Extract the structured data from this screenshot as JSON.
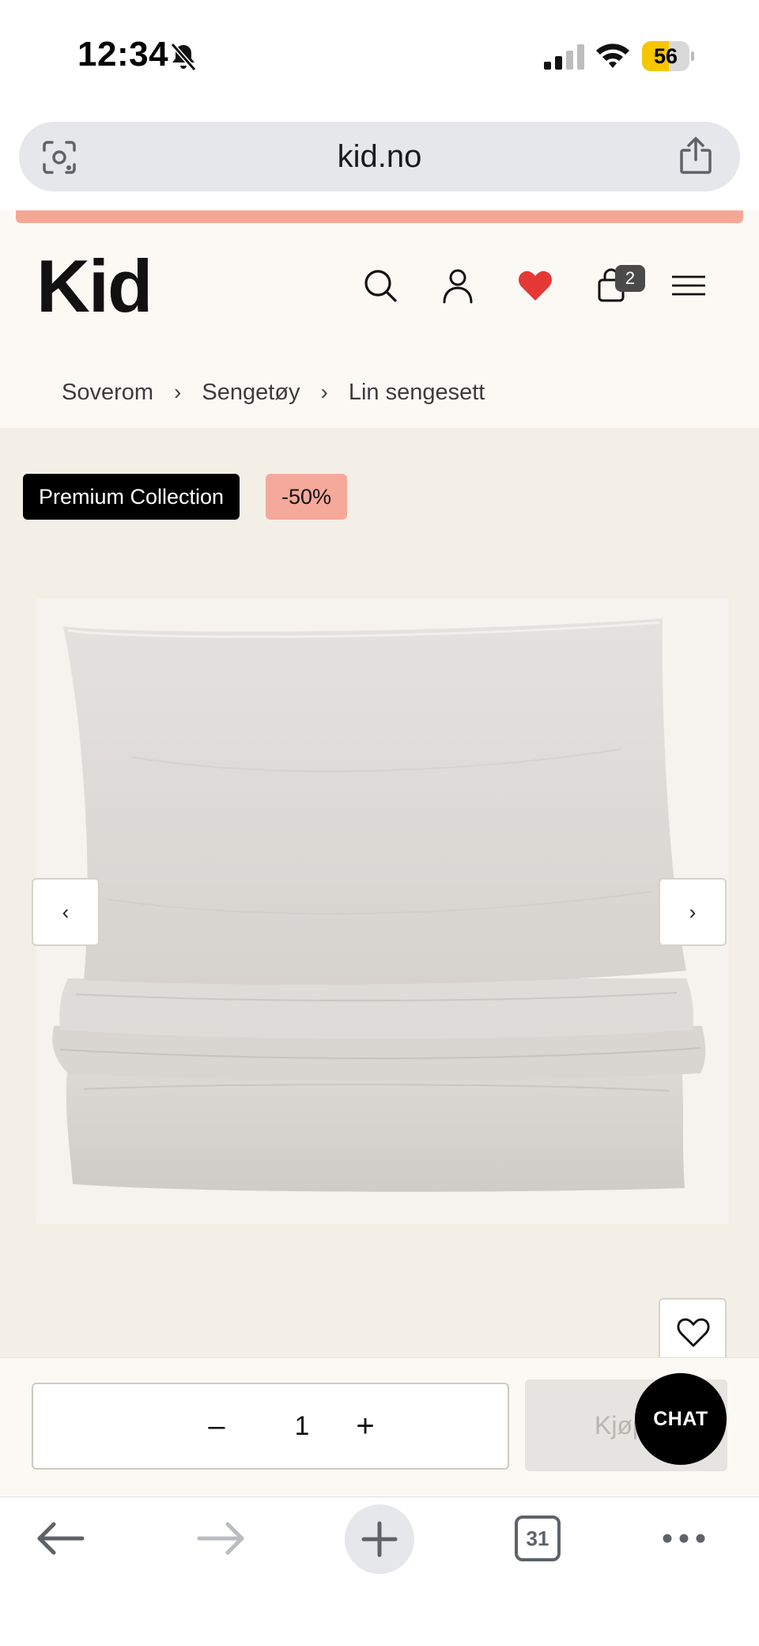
{
  "status_bar": {
    "time": "12:34",
    "battery_level": "56"
  },
  "browser": {
    "url": "kid.no",
    "open_tabs_count": "31"
  },
  "site": {
    "logo": "Kid",
    "cart_count": "2",
    "breadcrumb": [
      {
        "label": "Soverom"
      },
      {
        "label": "Sengetøy"
      },
      {
        "label": "Lin sengesett"
      }
    ],
    "separator": "›"
  },
  "product": {
    "badge_collection": "Premium Collection",
    "badge_discount": "-50%",
    "prev_label": "‹",
    "next_label": "›"
  },
  "purchase": {
    "qty_minus": "–",
    "quantity": "1",
    "qty_plus": "+",
    "buy_label": "Kjøp",
    "chat_label": "CHAT"
  },
  "colors": {
    "promo_strip": "#f5a796",
    "header_bg": "#fbf9f4",
    "product_bg": "#f3efe7",
    "heart": "#e53935",
    "battery": "#f6c700"
  }
}
